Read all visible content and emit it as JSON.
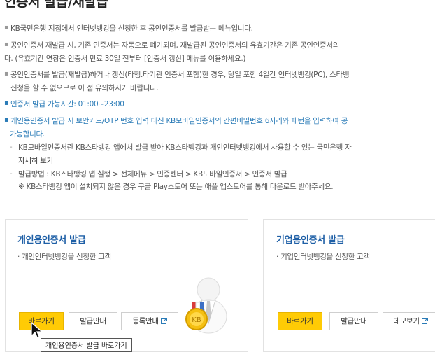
{
  "page": {
    "title": "인증서 발급/재발급"
  },
  "notes": [
    "KB국민은행 지점에서 인터넷뱅킹을 신청한 후 공인인증서를 발급받는 메뉴입니다.",
    "공인인증서 재발급 시, 기존 인증서는 자동으로 폐기되며, 재발급된 공인인증서의 유효기간은 기존 공인인증서의",
    "다. (유효기간 연장은 인증서 만료 30일 전부터 [인증서 갱신] 메뉴를 이용하세요.)",
    "공인인증서를 발급(재발급)하거나 갱신(타행.타기관 인증서 포함)한 경우, 당일 포함 4일간 인터넷뱅킹(PC), 스타뱅",
    "신청을 할 수 없으므로 이 점 유의하시기 바랍니다.",
    "인증서 발급 가능시간: 01:00~23:00",
    "개인용인증서 발급 시 보안카드/OTP 번호 입력 대신 KB모바일인증서의 간편비밀번호 6자리와 패턴을 입력하여 공",
    "가능합니다."
  ],
  "sub_notes": {
    "mobile_cert": "KB모바일인증서란 KB스타뱅킹 앱에서 발급 받아 KB스타뱅킹과 개인인터넷뱅킹에서 사용할 수 있는 국민은행 자",
    "detail_link": "자세히 보기",
    "method": "발급방법 : KB스타뱅킹 앱 실행 > 전체메뉴 > 인증센터 > KB모바일인증서 > 인증서 발급",
    "method_note": "※ KB스타뱅킹 앱이 설치되지 않은 경우 구글 Play스토어 또는 애플 앱스토어를 통해 다운로드 받아주세요."
  },
  "personal_card": {
    "title": "개인용인증서 발급",
    "desc": "· 개인인터넷뱅킹을 신청한 고객",
    "btn_go": "바로가기",
    "btn_guide": "발급안내",
    "btn_register": "등록안내"
  },
  "corporate_card": {
    "title": "기업용인증서 발급",
    "desc": "· 기업인터넷뱅킹을 신청한 고객",
    "btn_go": "바로가기",
    "btn_guide": "발급안내",
    "btn_demo": "데모보기"
  },
  "tooltip": "개인용인증서 발급 바로가기",
  "colors": {
    "accent": "#ffcb05",
    "title_blue": "#1e5fa6",
    "note_blue": "#2a7bb7"
  }
}
